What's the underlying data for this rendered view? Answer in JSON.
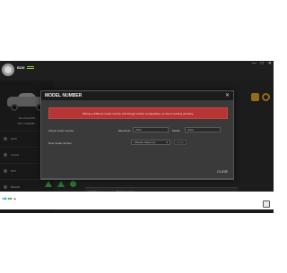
{
  "app": {
    "brand": "BDE"
  },
  "window": {
    "controls": [
      "—",
      "□",
      "✕"
    ]
  },
  "vehicle": {
    "model_line1": "Van Dual RST",
    "model_line2": "VIN: 1GNSKB..."
  },
  "sidebar": {
    "items": [
      {
        "label": "ECM"
      },
      {
        "label": "Cluster"
      },
      {
        "label": "DPF"
      },
      {
        "label": "BRAKE"
      }
    ]
  },
  "modal": {
    "title": "MODEL NUMBER",
    "close_glyph": "✕",
    "warning": "Writing a different model number will change vehicle configuration, at risk of existing warranty.",
    "actual_label": "Actual model number",
    "actual_value_label": "Electronic:",
    "actual_value": "2000",
    "actual_model_label": "Model:",
    "actual_model_value": "2000",
    "new_label": "New model number",
    "new_select": "<Please Select an",
    "apply_label": "Apply",
    "close_button": "CLOSE"
  },
  "background_table": {
    "col1": "Enable",
    "col2": "Models service"
  },
  "colors": {
    "accent": "#e7a22a",
    "alert": "#b53535",
    "ok": "#3fb34f"
  }
}
